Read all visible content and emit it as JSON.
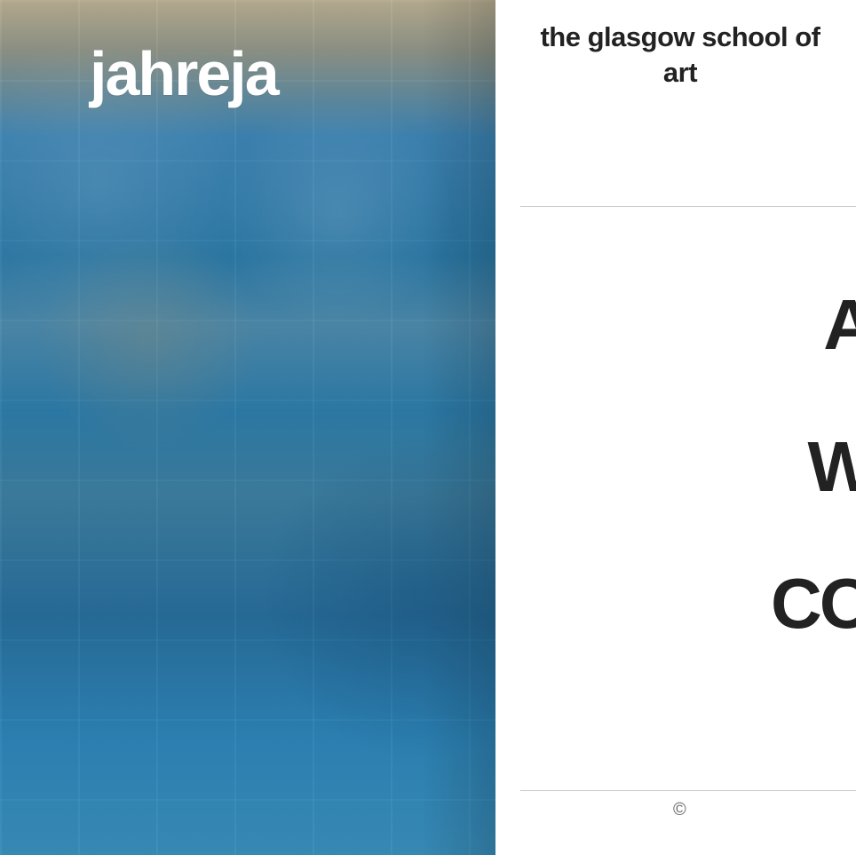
{
  "hero": {
    "title": "jahreja"
  },
  "brand": {
    "name": "the glasgow school of art"
  },
  "nav": {
    "items": [
      {
        "label": "A"
      },
      {
        "label": "W"
      },
      {
        "label": "CO"
      }
    ]
  },
  "footer": {
    "copyright": "©"
  },
  "colors": {
    "text": "#222222",
    "divider": "#c8c8c8",
    "background": "#ffffff"
  }
}
